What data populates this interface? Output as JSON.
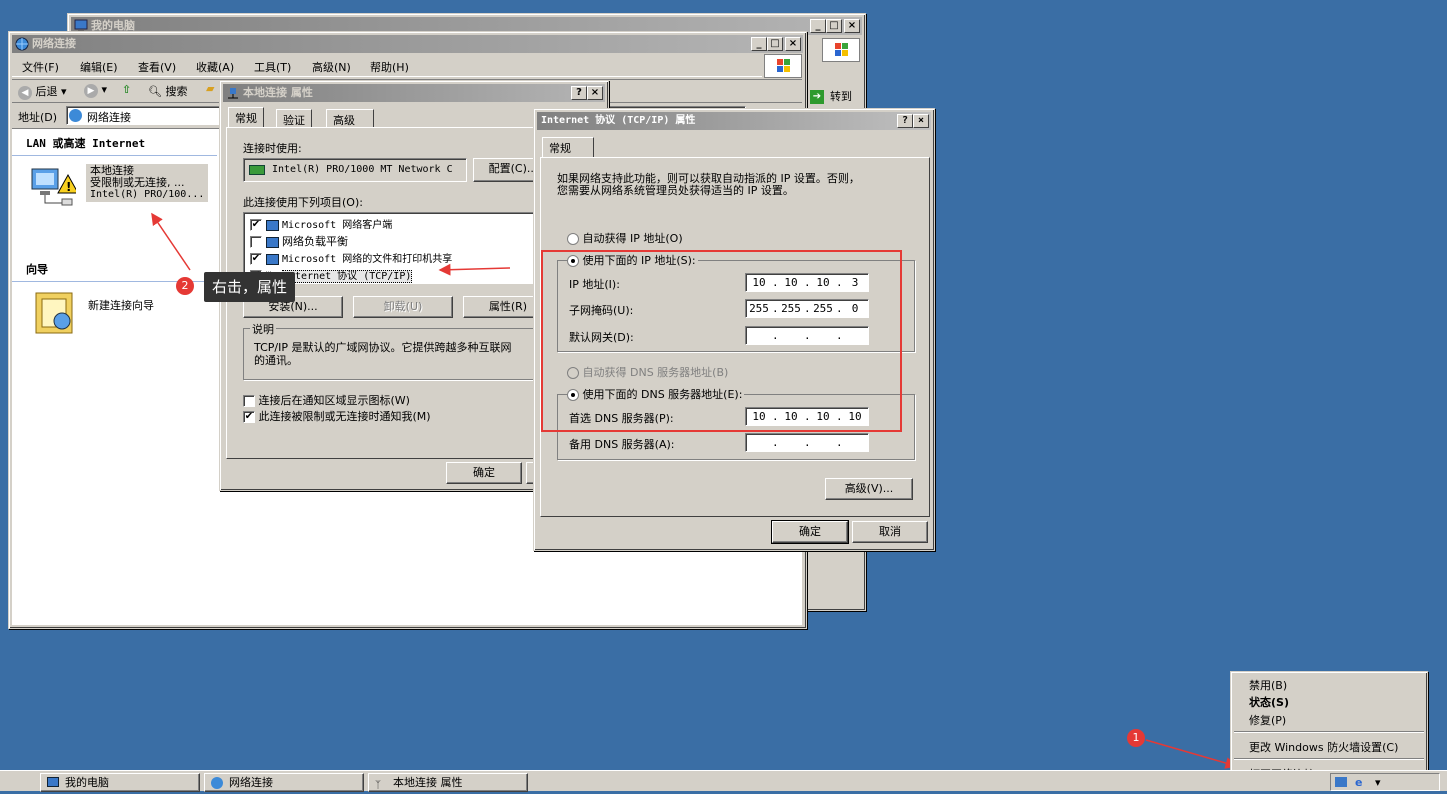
{
  "my_computer": {
    "title": "我的电脑",
    "go_label": "转到"
  },
  "netconn": {
    "title": "网络连接",
    "menu": [
      "文件(F)",
      "编辑(E)",
      "查看(V)",
      "收藏(A)",
      "工具(T)",
      "高级(N)",
      "帮助(H)"
    ],
    "toolbar": {
      "back": "后退",
      "search": "搜索"
    },
    "address_label": "地址(D)",
    "address_value": "网络连接",
    "lan_header": "LAN 或高速 Internet",
    "lan_name": "本地连接",
    "lan_status": "受限制或无连接, ...",
    "lan_device": "Intel(R) PRO/100...",
    "wizard_header": "向导",
    "wizard_item": "新建连接向导"
  },
  "local_props": {
    "title": "本地连接 属性",
    "tabs": [
      "常规",
      "验证",
      "高级"
    ],
    "connect_using_label": "连接时使用:",
    "adapter": "Intel(R) PRO/1000 MT Network C",
    "configure_btn": "配置(C)...",
    "items_label": "此连接使用下列项目(O):",
    "items": [
      {
        "label": "Microsoft 网络客户端",
        "checked": "✔"
      },
      {
        "label": "网络负载平衡",
        "checked": ""
      },
      {
        "label": "Microsoft 网络的文件和打印机共享",
        "checked": "✔"
      },
      {
        "label": "Internet 协议 (TCP/IP)",
        "checked": "✔"
      }
    ],
    "install_btn": "安装(N)...",
    "uninstall_btn": "卸载(U)",
    "properties_btn": "属性(R)",
    "desc_label": "说明",
    "desc_text": "TCP/IP 是默认的广域网协议。它提供跨越多种互联网络的通讯。",
    "desc_line1": "TCP/IP 是默认的广域网协议。它提供跨越多种互联网",
    "desc_line2": "的通讯。",
    "notify_icon_label": "连接后在通知区域显示图标(W)",
    "notify_icon_checked": "",
    "notify_limited_label": "此连接被限制或无连接时通知我(M)",
    "notify_limited_checked": "✔",
    "ok_btn": "确定"
  },
  "tcpip": {
    "title": "Internet 协议 (TCP/IP) 属性",
    "tab": "常规",
    "intro_line1": "如果网络支持此功能，则可以获取自动指派的 IP 设置。否则，",
    "intro_line2": "您需要从网络系统管理员处获得适当的 IP 设置。",
    "auto_ip": "自动获得 IP 地址(O)",
    "use_ip": "使用下面的 IP 地址(S):",
    "ip_label": "IP 地址(I):",
    "ip_value": [
      "10",
      "10",
      "10",
      "3"
    ],
    "mask_label": "子网掩码(U):",
    "mask_value": [
      "255",
      "255",
      "255",
      "0"
    ],
    "gateway_label": "默认网关(D):",
    "gateway_value": [
      "",
      "",
      "",
      ""
    ],
    "auto_dns": "自动获得 DNS 服务器地址(B)",
    "use_dns": "使用下面的 DNS 服务器地址(E):",
    "pref_dns_label": "首选 DNS 服务器(P):",
    "pref_dns_value": [
      "10",
      "10",
      "10",
      "10"
    ],
    "alt_dns_label": "备用 DNS 服务器(A):",
    "alt_dns_value": [
      "",
      "",
      "",
      ""
    ],
    "advanced_btn": "高级(V)...",
    "ok_btn": "确定",
    "cancel_btn": "取消"
  },
  "context_menu": {
    "items": [
      "禁用(B)",
      "状态(S)",
      "修复(P)",
      "更改 Windows 防火墙设置(C)",
      "打开网络连接(O)"
    ]
  },
  "annotations": {
    "step1": "1",
    "step2": "2",
    "step2_text": "右击，属性",
    "colors": {
      "badge": "#e53935",
      "highlight": "#e53935",
      "tooltip_bg": "#333333"
    }
  },
  "taskbar": {
    "items": [
      "我的电脑",
      "网络连接",
      "本地连接 属性"
    ]
  }
}
